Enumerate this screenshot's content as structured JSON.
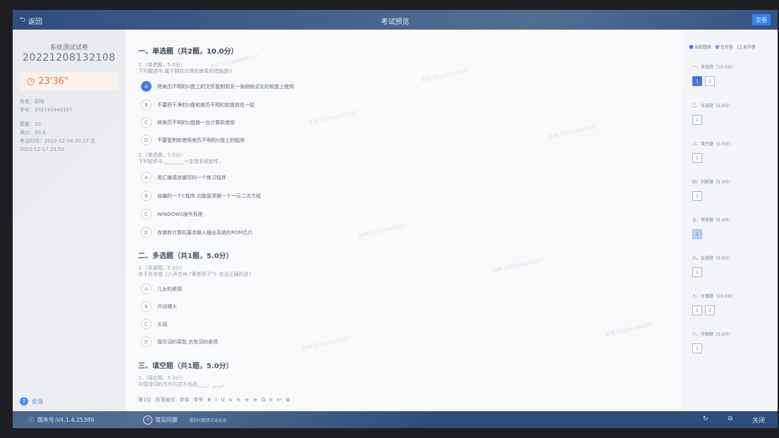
{
  "topbar": {
    "back_label": "返回",
    "title": "考试预览",
    "submit_label": "交卷"
  },
  "left": {
    "exam_name": "系统测试试卷",
    "exam_id": "20221208132108",
    "timer": "23'36\"",
    "info": [
      "姓名：彭晗",
      "学号：202143440107",
      "题量：10",
      "满分：50.0",
      "考试时间：2022-12-08 20:17 至",
      "2022-12-17 23:59"
    ],
    "feedback_label": "反馈"
  },
  "main": {
    "sections": [
      {
        "title": "一、单选题（共2题，10.0分）"
      },
      {
        "title": "二、多选题（共1题，5.0分）"
      },
      {
        "title": "三、填空题（共1题，5.0分）"
      }
    ],
    "q1": {
      "meta": "1.（单选题，5.0分）",
      "text": "下列叙述中,属于预防计算机病毒的措施是()",
      "options": [
        {
          "letter": "A",
          "text": "将来历不明的U盘上的文件复制到另一张刚格式化的软盘上使用"
        },
        {
          "letter": "B",
          "text": "不要把干净的U盘和来历不明的软盘放在一起"
        },
        {
          "letter": "C",
          "text": "将来历不明的U盘换一台计算机使用"
        },
        {
          "letter": "D",
          "text": "不要复制和使用来历不明的U盘上的程序"
        }
      ]
    },
    "q2": {
      "meta": "2.（单选题，5.0分）",
      "text": "下列软件中,________一定是系统软件。",
      "options": [
        {
          "letter": "A",
          "text": "用汇编语言编写的一个练习程序"
        },
        {
          "letter": "B",
          "text": "自编的一个C程序,功能是求解一个一元二次方程"
        },
        {
          "letter": "C",
          "text": "WINDOWS操作系统"
        },
        {
          "letter": "D",
          "text": "存储有计算机基本输入输出系统的ROM芯片"
        }
      ]
    },
    "q3": {
      "meta": "1.（多选题，5.0分）",
      "text": "关于苏东坡《八声甘州·“寄参寥子”》说法正确的是?",
      "options": [
        {
          "letter": "A",
          "text": "儿女的柔情"
        },
        {
          "letter": "B",
          "text": "开阔博大"
        },
        {
          "letter": "C",
          "text": "长调"
        },
        {
          "letter": "D",
          "text": "描写词的离愁,也有词的柔情"
        }
      ]
    },
    "q4": {
      "meta": "1.（填空题，5.0分）",
      "text": "中国诗词的写作方式不包括____、____。"
    },
    "editor": {
      "blank_label": "第1空",
      "tools": [
        "段落格式",
        "字体",
        "字号",
        "B",
        "I",
        "U",
        "A",
        "≡",
        "≡",
        "≡",
        "Ω",
        "π",
        "x²",
        "⊞"
      ]
    },
    "watermark_text": "彭晗 202143440107"
  },
  "right": {
    "legend": [
      "当前题目",
      "已作答",
      "未作答"
    ],
    "groups": [
      {
        "title": "一、单选题（10.0分）",
        "nums": [
          "1",
          "2"
        ]
      },
      {
        "title": "二、多选题（5.0分）",
        "nums": [
          "1"
        ]
      },
      {
        "title": "三、填空题（5.0分）",
        "nums": [
          "1"
        ]
      },
      {
        "title": "四、判断题（5.0分）",
        "nums": [
          "1"
        ]
      },
      {
        "title": "五、简答题（5.0分）",
        "nums": [
          "1"
        ]
      },
      {
        "title": "六、论述题（5.0分）",
        "nums": [
          "1"
        ]
      },
      {
        "title": "七、计算题（10.0分）",
        "nums": [
          "1",
          "2"
        ]
      },
      {
        "title": "八、作图题（5.0分）",
        "nums": [
          "1"
        ]
      }
    ]
  },
  "bottombar": {
    "version": "版本号:V4.1.4.25389",
    "faq": "常见问题",
    "hint": "遇到问题请点击此处",
    "close": "关闭"
  },
  "colors": {
    "accent": "#3a6fe0",
    "timer": "#e0703a",
    "bar": "#2f4d7c"
  }
}
